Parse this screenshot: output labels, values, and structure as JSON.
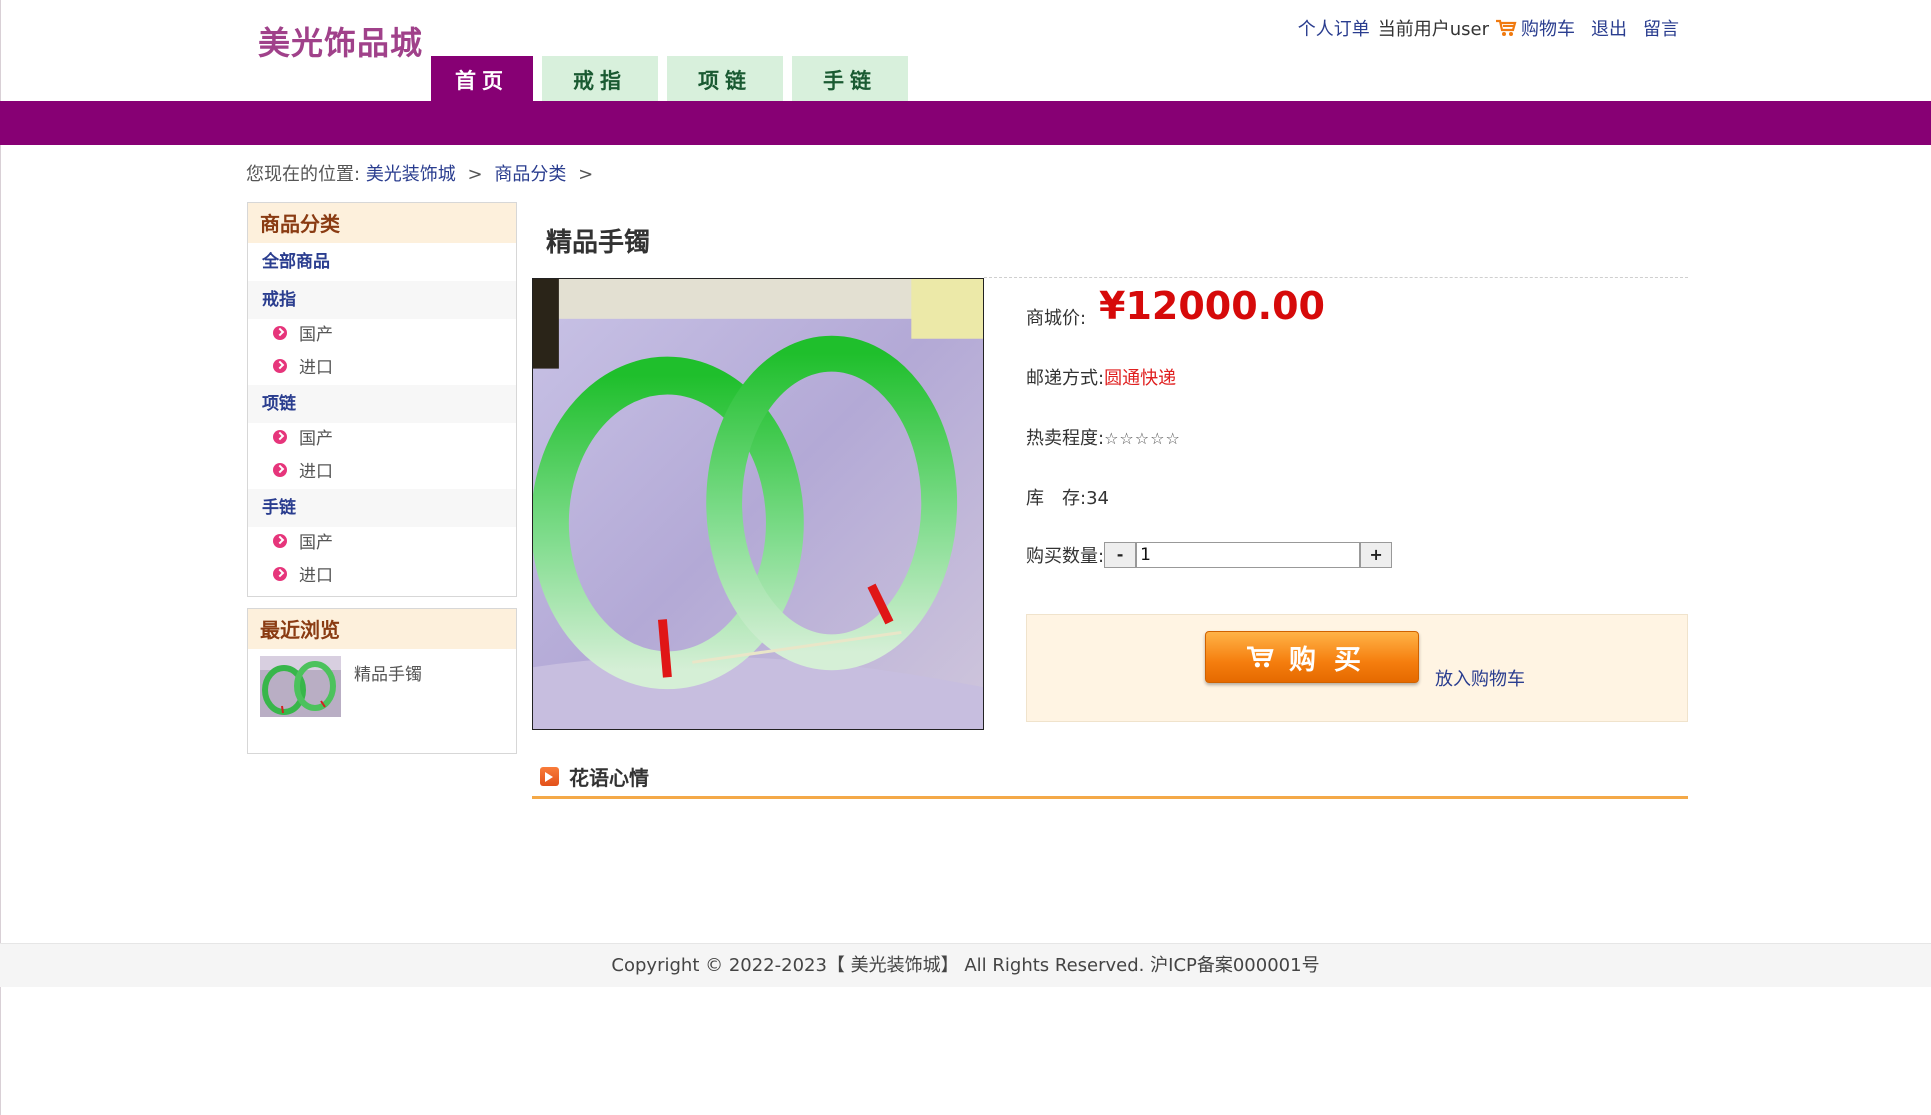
{
  "header": {
    "logo": "美光饰品城",
    "links": {
      "orders": "个人订单",
      "current_user": "当前用户user",
      "cart": "购物车",
      "logout": "退出",
      "message": "留言"
    }
  },
  "nav": {
    "tabs": [
      {
        "label": "首页",
        "active": true
      },
      {
        "label": "戒指",
        "active": false
      },
      {
        "label": "项链",
        "active": false
      },
      {
        "label": "手链",
        "active": false
      }
    ]
  },
  "breadcrumb": {
    "prefix": "您现在的位置:",
    "items": [
      "美光装饰城",
      "商品分类"
    ],
    "separator": ">"
  },
  "sidebar": {
    "category_title": "商品分类",
    "all": "全部商品",
    "groups": [
      {
        "name": "戒指",
        "subs": [
          "国产",
          "进口"
        ]
      },
      {
        "name": "项链",
        "subs": [
          "国产",
          "进口"
        ]
      },
      {
        "name": "手链",
        "subs": [
          "国产",
          "进口"
        ]
      }
    ],
    "recent_title": "最近浏览",
    "recent_items": [
      {
        "name": "精品手镯"
      }
    ]
  },
  "product": {
    "title": "精品手镯",
    "price_label": "商城价:",
    "price": "¥12000.00",
    "shipping_label": "邮递方式:",
    "shipping_value": "圆通快递",
    "hot_label": "热卖程度:",
    "hot_stars": "☆☆☆☆☆",
    "stock_label": "库　存:",
    "stock_value": "34",
    "qty_label": "购买数量:",
    "qty_minus": "-",
    "qty_value": "1",
    "qty_plus": "+",
    "buy_label": "购买",
    "add_cart_label": "放入购物车"
  },
  "section": {
    "title": "花语心情"
  },
  "footer": {
    "text": "Copyright © 2022-2023【 美光装饰城】 All Rights Reserved. 沪ICP备案000001号"
  },
  "colors": {
    "brand_purple": "#870074",
    "price_red": "#d60a0a",
    "tab_green_bg": "#d8f0dc",
    "buy_orange": "#f57e0e"
  }
}
